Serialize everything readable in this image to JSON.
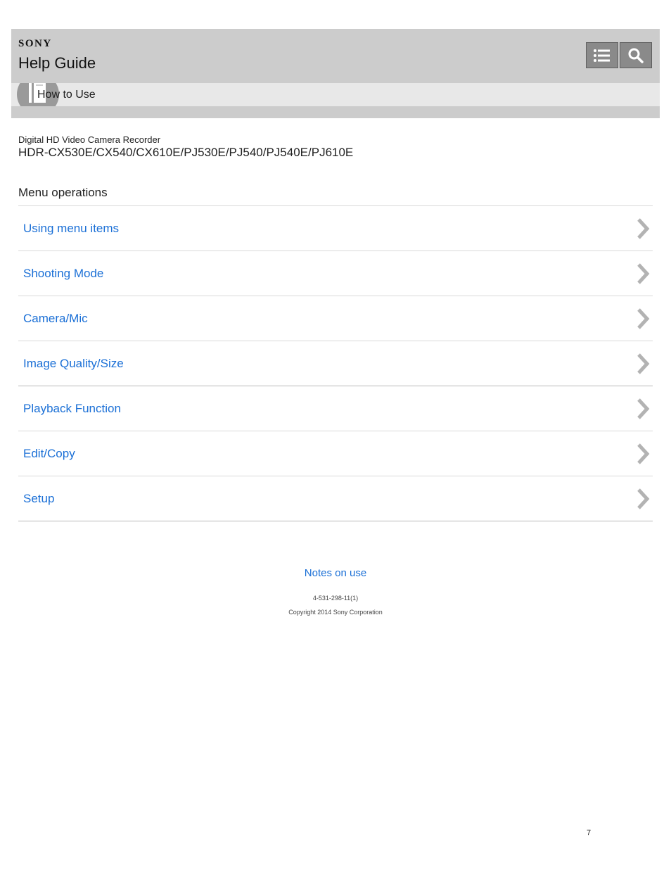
{
  "header": {
    "brand": "SONY",
    "title": "Help Guide",
    "toc_icon": "list-icon",
    "search_icon": "search-icon"
  },
  "section": {
    "label": "How to Use",
    "icon": "book-icon"
  },
  "product": {
    "type": "Digital HD Video Camera Recorder",
    "models": "HDR-CX530E/CX540/CX610E/PJ530E/PJ540/PJ540E/PJ610E"
  },
  "menu": {
    "heading": "Menu operations",
    "items": [
      {
        "label": "Using menu items"
      },
      {
        "label": "Shooting Mode"
      },
      {
        "label": "Camera/Mic"
      },
      {
        "label": "Image Quality/Size"
      },
      {
        "label": "Playback Function"
      },
      {
        "label": "Edit/Copy"
      },
      {
        "label": "Setup"
      }
    ],
    "chevron_icon": "chevron-right-icon"
  },
  "footer": {
    "notes_link": "Notes on use",
    "doc_number": "4-531-298-11(1)",
    "copyright": "Copyright 2014 Sony Corporation",
    "page_number": "7"
  },
  "colors": {
    "header_bg": "#cccccc",
    "link": "#1a6fd6",
    "button_bg": "#8a8a8a"
  }
}
